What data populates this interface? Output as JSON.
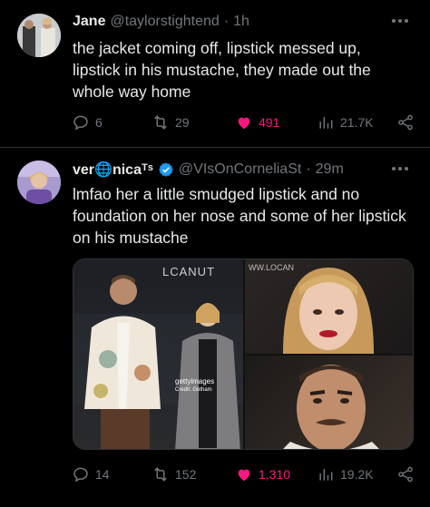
{
  "tweets": [
    {
      "name": "Jane",
      "handle": "@taylorstightend",
      "sep": "·",
      "time": "1h",
      "text": "the jacket coming off, lipstick messed up, lipstick in his mustache, they made out the whole way home",
      "replies": "6",
      "retweets": "29",
      "likes": "491",
      "views": "21.7K"
    },
    {
      "name": "ver🌐nicaᵀˢ",
      "handle": "@VIsOnCorneliaSt",
      "sep": "·",
      "time": "29m",
      "text": "lmfao her a little smudged lipstick and no foundation on her nose and some of her lipstick on his mustache",
      "replies": "14",
      "retweets": "152",
      "likes": "1,310",
      "views": "19.2K",
      "media": {
        "sign": "LCANUT",
        "sign2": "WW.LOCAN",
        "watermark": "gettyimages",
        "credit": "Credit: Gotham"
      }
    }
  ],
  "colors": {
    "like": "#f91880",
    "verified": "#1d9bf0",
    "muted": "#71767b"
  }
}
